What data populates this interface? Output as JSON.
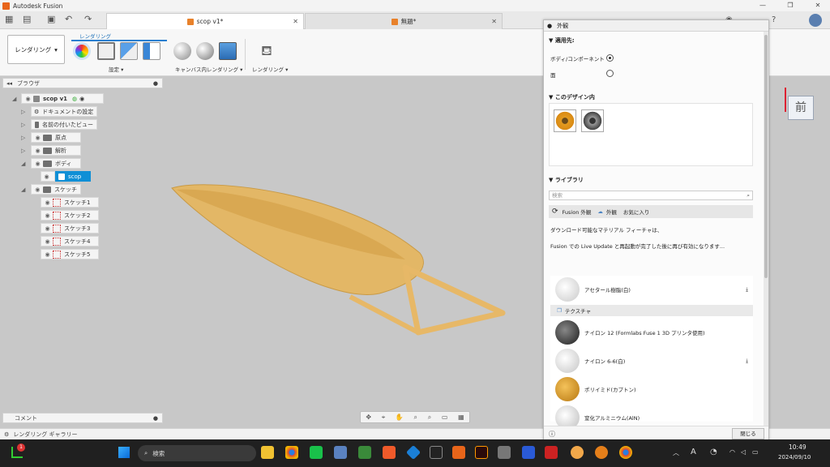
{
  "titlebar": {
    "app_title": "Autodesk Fusion"
  },
  "tabs": [
    {
      "label": "scop v1*"
    },
    {
      "label": "無題*"
    }
  ],
  "toolbar": {
    "workspace": "レンダリング",
    "active_tab": "レンダリング",
    "groups": [
      {
        "label": "設定"
      },
      {
        "label": "キャンバス内レンダリング"
      },
      {
        "label": "レンダリング"
      }
    ]
  },
  "browser": {
    "title": "ブラウザ",
    "root": "scop v1",
    "items": [
      {
        "label": "ドキュメントの設定"
      },
      {
        "label": "名前の付いたビュー"
      },
      {
        "label": "原点"
      },
      {
        "label": "解析"
      },
      {
        "label": "ボディ"
      },
      {
        "label": "scop"
      },
      {
        "label": "スケッチ"
      },
      {
        "label": "スケッチ1"
      },
      {
        "label": "スケッチ2"
      },
      {
        "label": "スケッチ3"
      },
      {
        "label": "スケッチ4"
      },
      {
        "label": "スケッチ5"
      }
    ]
  },
  "comments": {
    "label": "コメント"
  },
  "gallery": {
    "label": "レンダリング ギャラリー"
  },
  "viewcube": {
    "face": "前"
  },
  "appearance": {
    "title": "外観",
    "apply_to": {
      "title": "適用先:",
      "options": [
        {
          "label": "ボディ/コンポーネント",
          "selected": true
        },
        {
          "label": "面",
          "selected": false
        }
      ]
    },
    "in_design": {
      "title": "このデザイン内"
    },
    "library": {
      "title": "ライブラリ",
      "search_placeholder": "検索",
      "tab_fusion": "Fusion 外観",
      "tab_mine": "外観",
      "tab_fav": "お気に入り",
      "notice_1": "ダウンロード可能なマテリアル フィーチャは、",
      "notice_2": "Fusion での Live Update と再起動が完了した後に再び有効になります...",
      "category": "テクスチャ",
      "materials": [
        {
          "name": "アセタール樹脂(白)",
          "color": "#e4e4e4",
          "download": true
        },
        {
          "name": "ナイロン 12 (Formlabs Fuse 1 3D プリンタ使用)",
          "color": "#2e2e2e",
          "download": false
        },
        {
          "name": "ナイロン 6-6(白)",
          "color": "#e8e8e8",
          "download": true
        },
        {
          "name": "ポリイミド(カプトン)",
          "color": "#d99a22",
          "download": false
        },
        {
          "name": "窒化アルミニウム(AlN)",
          "color": "#dcdcdc",
          "download": false
        }
      ]
    },
    "close_button": "閉じる"
  },
  "taskbar": {
    "search": "検索",
    "notification_count": "1",
    "ime": "A",
    "time": "10:49",
    "date": "2024/09/10"
  },
  "colors": {
    "model": "#e7b867",
    "selection": "#0f8fd6",
    "accent": "#e8651a"
  }
}
